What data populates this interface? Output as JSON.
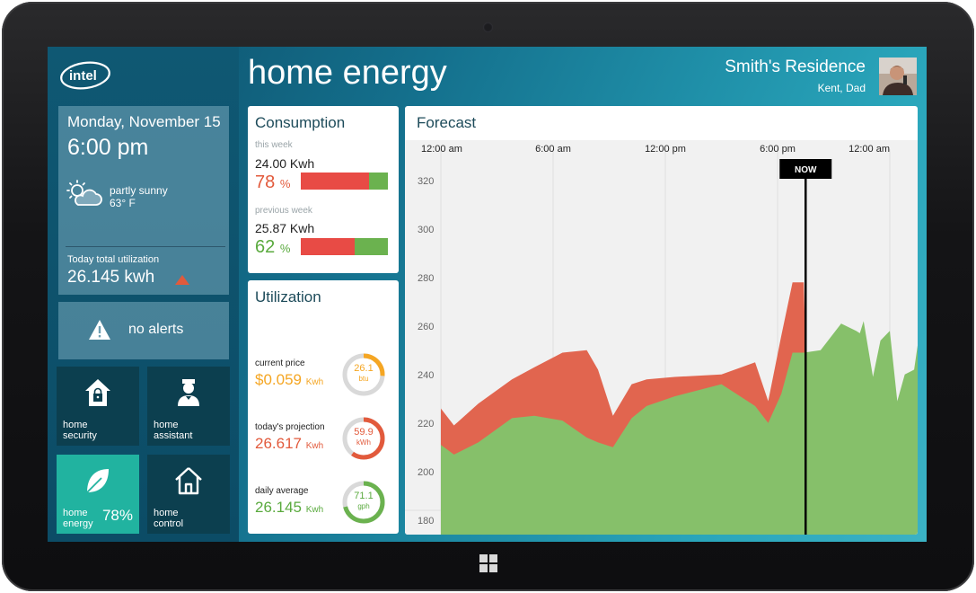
{
  "app": {
    "brand": "intel",
    "title": "home energy"
  },
  "user": {
    "residence": "Smith's Residence",
    "members": "Kent, Dad"
  },
  "status": {
    "date": "Monday, November 15",
    "time": "6:00  pm",
    "weather_condition": "partly sunny",
    "weather_temp": "63° F",
    "today_label": "Today total utilization",
    "today_value": "26.145 kwh",
    "trend": "up",
    "alerts": "no alerts"
  },
  "tiles": {
    "security": "home security",
    "assistant": "home assistant",
    "energy": "home energy",
    "energy_pct": "78%",
    "control": "home control"
  },
  "consumption": {
    "title": "Consumption",
    "this_week": {
      "label": "this week",
      "value": "24.00 Kwh",
      "pct_num": "78",
      "pct_sign": "%",
      "fraction": 0.78
    },
    "previous_week": {
      "label": "previous week",
      "value": "25.87 Kwh",
      "pct_num": "62",
      "pct_sign": "%",
      "fraction": 0.62
    }
  },
  "utilization": {
    "title": "Utilization",
    "items": [
      {
        "label": "current price",
        "value": "$0.059",
        "unit": "Kwh",
        "ring_value": "26.1",
        "ring_unit": "btu",
        "fraction": 0.26,
        "color": "#f5a623"
      },
      {
        "label": "today's projection",
        "value": "26.617",
        "unit": "Kwh",
        "ring_value": "59.9",
        "ring_unit": "kWh",
        "fraction": 0.6,
        "color": "#e25a3c"
      },
      {
        "label": "daily average",
        "value": "26.145",
        "unit": "Kwh",
        "ring_value": "71.1",
        "ring_unit": "gph",
        "fraction": 0.71,
        "color": "#6bb24f"
      }
    ]
  },
  "forecast": {
    "title": "Forecast",
    "now_label": "NOW",
    "colors": {
      "usage": "#e1654f",
      "baseline": "#86c06a",
      "plot_bg": "#f1f1f1"
    },
    "chart_data": {
      "type": "area",
      "x_ticks": [
        "12:00 am",
        "6:00 am",
        "12:00 pm",
        "6:00 pm",
        "12:00 am"
      ],
      "y_ticks": [
        320,
        300,
        280,
        260,
        240,
        220,
        200,
        180
      ],
      "x_range_hours": [
        0,
        24
      ],
      "ylim": [
        174,
        334
      ],
      "now_hour": 19.5,
      "series": [
        {
          "points": [
            [
              0,
              226
            ],
            [
              0.7,
              219
            ],
            [
              2,
              228
            ],
            [
              3.8,
              238
            ],
            [
              5,
              243
            ],
            [
              6.5,
              249
            ],
            [
              7.8,
              250
            ],
            [
              8.4,
              242
            ],
            [
              9.2,
              223
            ],
            [
              10.2,
              236
            ],
            [
              11,
              238
            ],
            [
              12.5,
              239
            ],
            [
              15,
              240
            ],
            [
              16.8,
              245
            ],
            [
              17.5,
              229
            ],
            [
              18.2,
              256
            ],
            [
              18.8,
              278
            ],
            [
              19.4,
              278
            ],
            [
              19.5,
              248
            ]
          ]
        },
        {
          "points": [
            [
              0,
              211
            ],
            [
              0.7,
              207
            ],
            [
              2,
              212
            ],
            [
              3.8,
              222
            ],
            [
              5,
              223
            ],
            [
              6.5,
              221
            ],
            [
              7.8,
              214
            ],
            [
              8.4,
              212
            ],
            [
              9.2,
              210
            ],
            [
              10.2,
              222
            ],
            [
              11,
              227
            ],
            [
              12.5,
              231
            ],
            [
              15,
              236
            ],
            [
              16.8,
              227
            ],
            [
              17.5,
              220
            ],
            [
              18.2,
              232
            ],
            [
              18.8,
              249
            ],
            [
              19.4,
              249
            ],
            [
              20.3,
              250
            ],
            [
              21.4,
              261
            ],
            [
              22.2,
              258
            ],
            [
              22.4,
              257
            ],
            [
              22.6,
              262
            ],
            [
              23.1,
              239
            ],
            [
              23.5,
              254
            ],
            [
              24,
              258
            ],
            [
              24.4,
              229
            ],
            [
              24.8,
              240
            ],
            [
              25.3,
              242
            ],
            [
              25.6,
              258
            ]
          ]
        }
      ]
    }
  }
}
